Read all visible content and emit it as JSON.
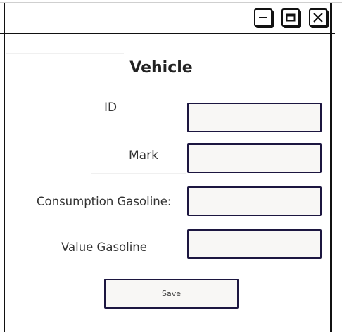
{
  "window": {
    "controls": {
      "minimize_icon": "minimize-icon",
      "maximize_icon": "maximize-icon",
      "close_icon": "close-icon"
    }
  },
  "form": {
    "title": "Vehicle",
    "fields": [
      {
        "label": "ID",
        "value": ""
      },
      {
        "label": "Mark",
        "value": ""
      },
      {
        "label": "Consumption Gasoline:",
        "value": ""
      },
      {
        "label": "Value Gasoline",
        "value": ""
      }
    ],
    "save_label": "Save"
  },
  "colors": {
    "border": "#111111",
    "field_border": "#1c1640",
    "field_background": "#f8f7f5"
  }
}
